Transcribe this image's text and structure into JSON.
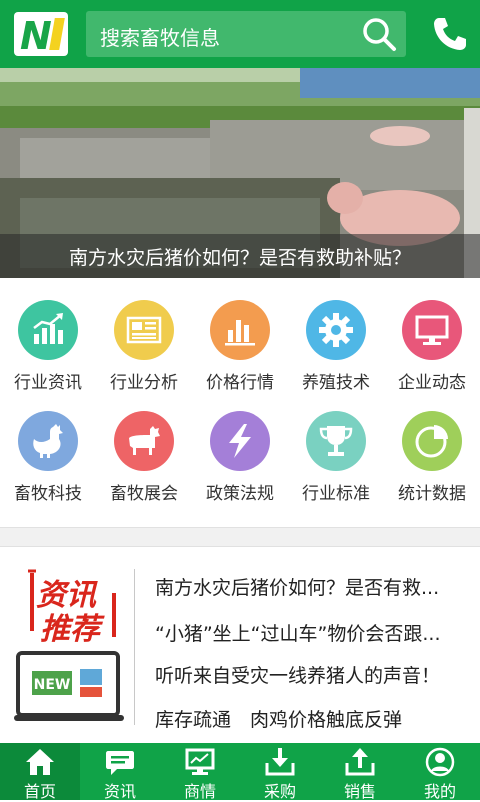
{
  "header": {
    "search_placeholder": "搜索畜牧信息"
  },
  "banner": {
    "caption": "南方水灾后猪价如何？是否有救助补贴？"
  },
  "categories": [
    {
      "label": "行业资讯",
      "icon": "chart-growth-icon",
      "color": "#3ec5a0"
    },
    {
      "label": "行业分析",
      "icon": "newspaper-icon",
      "color": "#f0cc4d"
    },
    {
      "label": "价格行情",
      "icon": "bar-chart-icon",
      "color": "#f39c4f"
    },
    {
      "label": "养殖技术",
      "icon": "gear-icon",
      "color": "#4fb7e6"
    },
    {
      "label": "企业动态",
      "icon": "monitor-icon",
      "color": "#e8577a"
    },
    {
      "label": "畜牧科技",
      "icon": "rooster-icon",
      "color": "#7fa8de"
    },
    {
      "label": "畜牧展会",
      "icon": "cow-icon",
      "color": "#ee6466"
    },
    {
      "label": "政策法规",
      "icon": "lightning-icon",
      "color": "#a47fd8"
    },
    {
      "label": "行业标准",
      "icon": "trophy-icon",
      "color": "#7ad1c1"
    },
    {
      "label": "统计数据",
      "icon": "pie-chart-icon",
      "color": "#9fcf5a"
    }
  ],
  "recommend": {
    "title_line1": "资讯",
    "title_line2": "推荐",
    "badge": "NEW",
    "items": [
      "南方水灾后猪价如何？是否有救...",
      "“小猪”坐上“过山车”物价会否跟...",
      "听听来自受灾一线养猪人的声音！",
      "库存疏通　肉鸡价格触底反弹"
    ]
  },
  "nav": [
    {
      "label": "首页",
      "icon": "home-icon",
      "active": true
    },
    {
      "label": "资讯",
      "icon": "message-icon",
      "active": false
    },
    {
      "label": "商情",
      "icon": "monitor-icon",
      "active": false
    },
    {
      "label": "采购",
      "icon": "download-icon",
      "active": false
    },
    {
      "label": "销售",
      "icon": "upload-icon",
      "active": false
    },
    {
      "label": "我的",
      "icon": "user-icon",
      "active": false
    }
  ],
  "colors": {
    "brand_green": "#10a348",
    "active_tab": "#0c8a3a",
    "recommend_red": "#d9261c"
  }
}
